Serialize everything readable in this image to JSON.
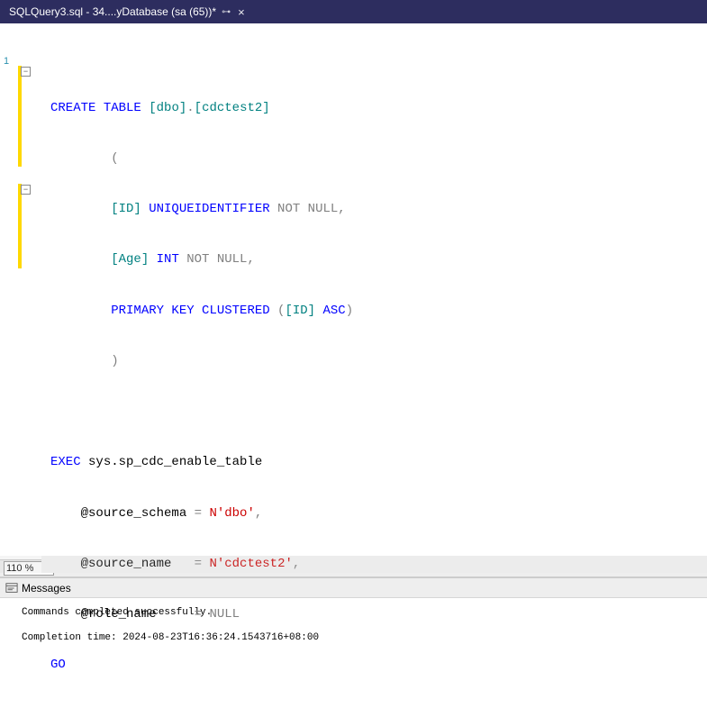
{
  "tab": {
    "title": "SQLQuery3.sql - 34....yDatabase (sa (65))*"
  },
  "gutter": {
    "line1": "1"
  },
  "code": {
    "l1": {
      "t1": "CREATE",
      "t2": " TABLE",
      "t3": " [dbo]",
      "t4": ".",
      "t5": "[cdctest2]"
    },
    "l2": "        (",
    "l3": {
      "pre": "        ",
      "t1": "[ID]",
      "t2": " UNIQUEIDENTIFIER",
      "t3": " NOT",
      "t4": " NULL",
      "t5": ","
    },
    "l4": {
      "pre": "        ",
      "t1": "[Age]",
      "t2": " INT",
      "t3": " NOT",
      "t4": " NULL",
      "t5": ","
    },
    "l5": {
      "pre": "        ",
      "t1": "PRIMARY",
      "t2": " KEY",
      "t3": " CLUSTERED",
      "t4": " (",
      "t5": "[ID]",
      "t6": " ASC",
      "t7": ")"
    },
    "l6": "        )",
    "l7": "",
    "l8": {
      "t1": "EXEC",
      "t2": " sys.sp_cdc_enable_table"
    },
    "l9": {
      "pre": "    ",
      "t1": "@source_schema",
      "t2": " = ",
      "t3": "N'dbo'",
      "t4": ","
    },
    "l10": {
      "pre": "    ",
      "t1": "@source_name",
      "t2": "   = ",
      "t3": "N'cdctest2'",
      "t4": ","
    },
    "l11": {
      "pre": "    ",
      "t1": "@role_name",
      "t2": "     = ",
      "t3": "NULL"
    },
    "l12": "GO"
  },
  "zoom": {
    "value": "110 %"
  },
  "messages": {
    "tab": "Messages",
    "line1": "Commands completed successfully.",
    "line2": "Completion time: 2024-08-23T16:36:24.1543716+08:00"
  }
}
